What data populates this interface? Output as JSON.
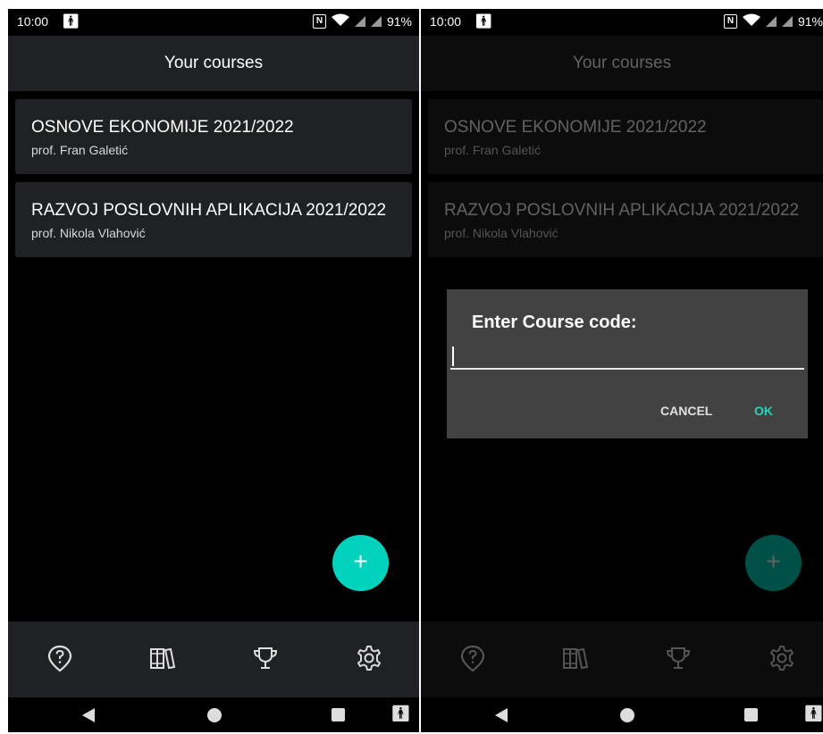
{
  "status_bar": {
    "time": "10:00",
    "battery": "91%",
    "nfc": "N"
  },
  "app_bar": {
    "title": "Your courses"
  },
  "courses": [
    {
      "title": "OSNOVE EKONOMIJE 2021/2022",
      "professor": "prof. Fran Galetić"
    },
    {
      "title": "RAZVOJ POSLOVNIH APLIKACIJA 2021/2022",
      "professor": "prof. Nikola Vlahović"
    }
  ],
  "fab": {
    "label": "+"
  },
  "bottom_nav": {
    "items": [
      "location-help-icon",
      "library-icon",
      "trophy-icon",
      "settings-icon"
    ]
  },
  "dialog": {
    "title": "Enter Course code:",
    "input_value": "",
    "cancel_label": "CANCEL",
    "ok_label": "OK"
  },
  "colors": {
    "accent": "#00d2be",
    "surface": "#202124",
    "dialog": "#424242",
    "ok_text": "#2ad4b6"
  }
}
